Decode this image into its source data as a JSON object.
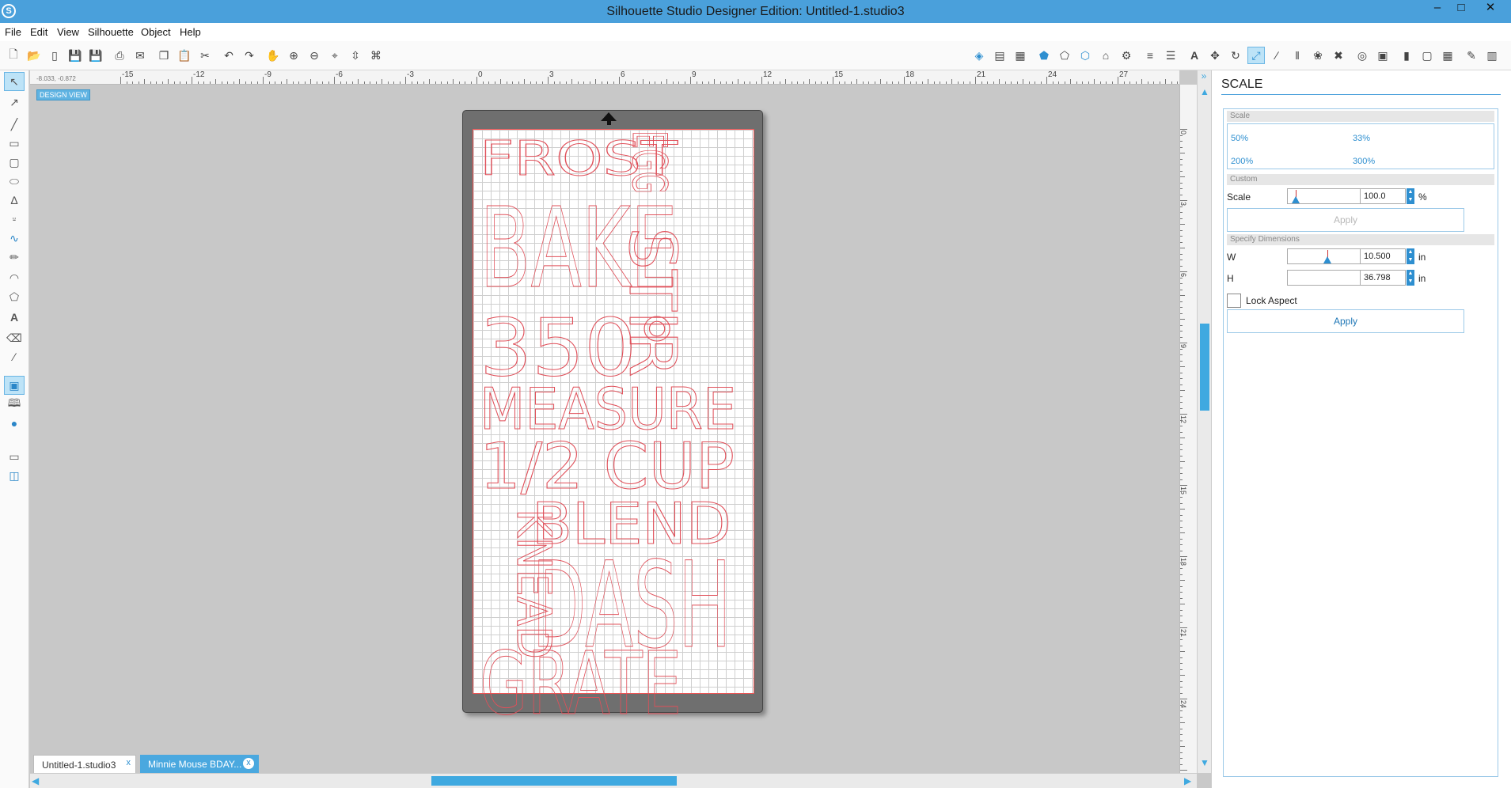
{
  "window": {
    "title": "Silhouette Studio Designer Edition: Untitled-1.studio3",
    "logo": "S",
    "minimize": "–",
    "maximize": "□",
    "close": "✕"
  },
  "menu": [
    "File",
    "Edit",
    "View",
    "Silhouette",
    "Object",
    "Help"
  ],
  "ruler": {
    "h_labels": [
      "-15",
      "-12",
      "-9",
      "-6",
      "-3",
      "0",
      "3",
      "6",
      "9",
      "12",
      "15",
      "18",
      "21",
      "24",
      "27"
    ],
    "v_labels": [
      "0",
      "3",
      "6",
      "9",
      "12",
      "15",
      "18",
      "21",
      "24"
    ],
    "coords": "-8.033, -0.872"
  },
  "canvas": {
    "design_view_label": "DESIGN VIEW",
    "words": [
      "FROST",
      "BAKE",
      "350°",
      "MEASURE",
      "1/2 CUP",
      "BLEND",
      "DASH",
      "KNEAD",
      "GRATE",
      "STIR",
      "EGG"
    ]
  },
  "tabs": [
    {
      "label": "Untitled-1.studio3",
      "close": "x"
    },
    {
      "label": "Minnie Mouse BDAY...",
      "close": "x"
    }
  ],
  "panel": {
    "title": "SCALE",
    "scale_section": "Scale",
    "presets": [
      "50%",
      "33%",
      "200%",
      "300%"
    ],
    "custom_section": "Custom",
    "scale_label": "Scale",
    "scale_value": "100.0",
    "scale_unit": "%",
    "apply_label": "Apply",
    "dims_section": "Specify Dimensions",
    "w_label": "W",
    "w_value": "10.500",
    "w_unit": "in",
    "h_label": "H",
    "h_value": "36.798",
    "h_unit": "in",
    "lock_label": "Lock Aspect",
    "apply2_label": "Apply"
  },
  "colors": {
    "accent": "#4aa0db",
    "cut_line": "#e0505a"
  }
}
